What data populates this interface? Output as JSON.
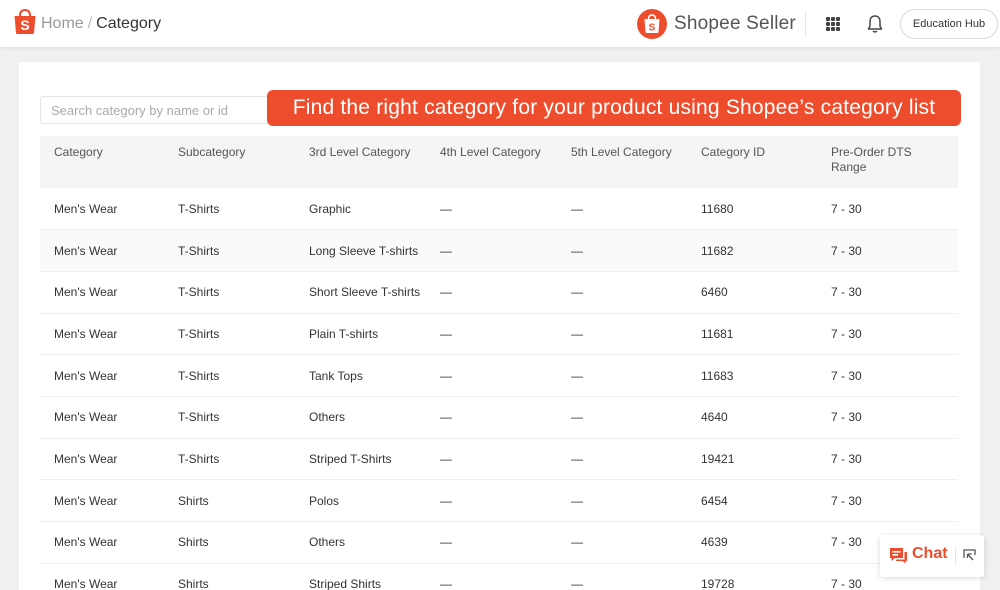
{
  "header": {
    "breadcrumb_home": "Home",
    "breadcrumb_separator": "/",
    "breadcrumb_current": "Category",
    "brand_name": "Shopee Seller",
    "education_hub_label": "Education Hub",
    "icons": [
      "shopee-bag-icon",
      "apps-grid-icon",
      "bell-icon"
    ]
  },
  "search": {
    "placeholder": "Search category by name or id",
    "value": ""
  },
  "banner": {
    "text": "Find the right category for your product using Shopee’s category list"
  },
  "table": {
    "columns": [
      "Category",
      "Subcategory",
      "3rd Level Category",
      "4th Level Category",
      "5th Level Category",
      "Category ID",
      "Pre-Order DTS Range"
    ],
    "rows": [
      [
        "Men's Wear",
        "T-Shirts",
        "Graphic",
        "—",
        "—",
        "11680",
        "7 - 30"
      ],
      [
        "Men's Wear",
        "T-Shirts",
        "Long Sleeve T-shirts",
        "—",
        "—",
        "11682",
        "7 - 30"
      ],
      [
        "Men's Wear",
        "T-Shirts",
        "Short Sleeve T-shirts",
        "—",
        "—",
        "6460",
        "7 - 30"
      ],
      [
        "Men's Wear",
        "T-Shirts",
        "Plain T-shirts",
        "—",
        "—",
        "11681",
        "7 - 30"
      ],
      [
        "Men's Wear",
        "T-Shirts",
        "Tank Tops",
        "—",
        "—",
        "11683",
        "7 - 30"
      ],
      [
        "Men's Wear",
        "T-Shirts",
        "Others",
        "—",
        "—",
        "4640",
        "7 - 30"
      ],
      [
        "Men's Wear",
        "T-Shirts",
        "Striped T-Shirts",
        "—",
        "—",
        "19421",
        "7 - 30"
      ],
      [
        "Men's Wear",
        "Shirts",
        "Polos",
        "—",
        "—",
        "6454",
        "7 - 30"
      ],
      [
        "Men's Wear",
        "Shirts",
        "Others",
        "—",
        "—",
        "4639",
        "7 - 30"
      ],
      [
        "Men's Wear",
        "Shirts",
        "Striped Shirts",
        "—",
        "—",
        "19728",
        "7 - 30"
      ]
    ]
  },
  "chat": {
    "label": "Chat",
    "icons": [
      "chat-bubble-icon",
      "expand-icon"
    ]
  },
  "colors": {
    "brand": "#ee4d2d",
    "background": "#f0f0f0",
    "header_row": "#f5f5f5",
    "hover_row": "#fafafa"
  }
}
